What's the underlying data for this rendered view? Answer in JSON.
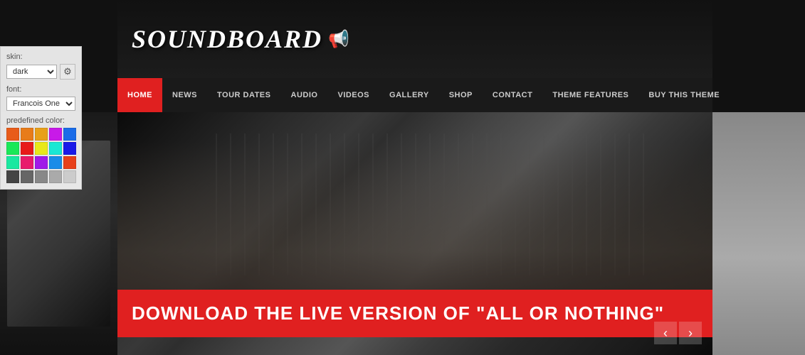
{
  "site": {
    "logo": "SOUNDBOARD",
    "logo_icon": "📢"
  },
  "settings": {
    "skin_label": "skin:",
    "skin_value": "dark",
    "font_label": "font:",
    "font_value": "Francois One",
    "predefined_color_label": "predefined color:",
    "gear_icon": "⚙"
  },
  "colors": [
    "#e85c1a",
    "#e87c1a",
    "#e8a01a",
    "#c81ae8",
    "#1a6ce8",
    "#1ae858",
    "#e81a1a",
    "#e8e81a",
    "#1ae8d4",
    "#1a1ae8",
    "#1ae8a0",
    "#e81a6c",
    "#a01ae8",
    "#1a8ce8",
    "#e8401a",
    "#444444",
    "#666666",
    "#888888",
    "#aaaaaa",
    "#cccccc"
  ],
  "nav": {
    "items": [
      {
        "label": "HOME",
        "active": true
      },
      {
        "label": "NEWS",
        "active": false
      },
      {
        "label": "TOUR DATES",
        "active": false
      },
      {
        "label": "AUDIO",
        "active": false
      },
      {
        "label": "VIDEOS",
        "active": false
      },
      {
        "label": "GALLERY",
        "active": false
      },
      {
        "label": "SHOP",
        "active": false
      },
      {
        "label": "CONTACT",
        "active": false
      },
      {
        "label": "THEME FEATURES",
        "active": false
      },
      {
        "label": "BUY THIS THEME",
        "active": false
      }
    ]
  },
  "hero": {
    "banner_text": "DOWNLOAD THE LIVE VERSION OF \"ALL OR NOTHING\""
  },
  "arrows": {
    "left": "‹",
    "right": "›"
  }
}
